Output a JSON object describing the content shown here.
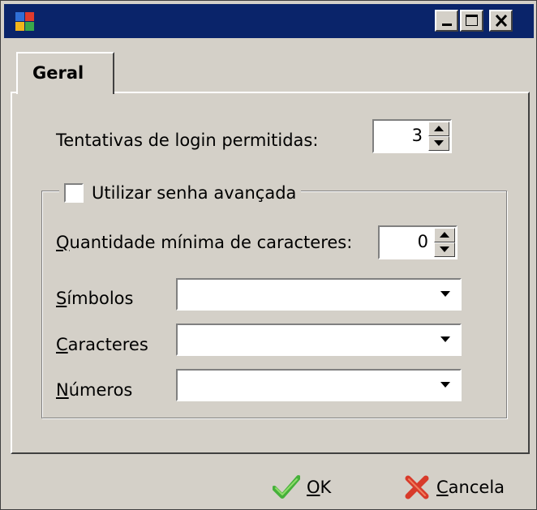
{
  "window": {
    "title": "",
    "controls": [
      "minimize-icon",
      "maximize-icon",
      "close-icon"
    ],
    "colors": {
      "titlebar": "#0a246a",
      "face": "#d4d0c8"
    }
  },
  "tabs": [
    {
      "label": "Geral",
      "selected": true
    }
  ],
  "login_attempts": {
    "label": "Tentativas de login permitidas:",
    "value": "3"
  },
  "advanced_password": {
    "label": "Utilizar senha avançada",
    "checked": false,
    "min_chars": {
      "label_prefix": "",
      "label_ul": "Q",
      "label_rest": "uantidade mínima de caracteres:",
      "value": "0"
    },
    "symbols": {
      "label_ul": "S",
      "label_rest": "ímbolos",
      "value": ""
    },
    "characters": {
      "label_ul": "C",
      "label_rest": "aracteres",
      "value": ""
    },
    "numbers": {
      "label_ul": "N",
      "label_rest": "úmeros",
      "value": ""
    }
  },
  "buttons": {
    "ok": {
      "label_ul": "O",
      "label_rest": "K",
      "icon": "checkmark-icon"
    },
    "cancel": {
      "label_ul": "C",
      "label_rest": "ancela",
      "icon": "x-icon"
    }
  }
}
